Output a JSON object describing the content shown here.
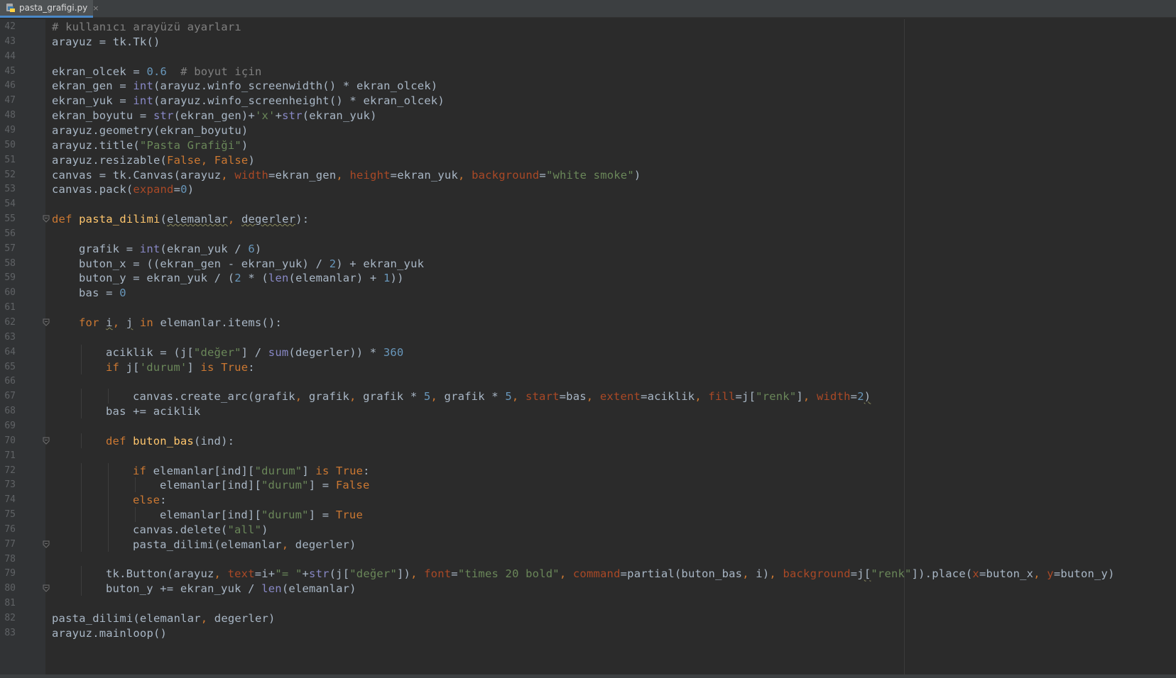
{
  "tab": {
    "filename": "pasta_grafigi.py",
    "close_glyph": "×",
    "icon": "python-file-icon",
    "accent_color": "#4a88c7"
  },
  "colors": {
    "background": "#2b2b2b",
    "gutter": "#313335",
    "keyword": "#cc7832",
    "function": "#ffc66d",
    "string": "#6a8759",
    "number": "#6897bb",
    "comment": "#808080",
    "parameter": "#aa4926",
    "builtin": "#8888c6",
    "text": "#a9b7c6"
  },
  "lines": [
    {
      "n": "42",
      "indent": 0,
      "fold": false,
      "tokens": [
        {
          "t": "# kullanıcı arayüzü ayarları",
          "c": "com"
        }
      ]
    },
    {
      "n": "43",
      "indent": 0,
      "fold": false,
      "tokens": [
        {
          "t": "arayuz = tk.Tk()",
          "c": "tx"
        }
      ]
    },
    {
      "n": "44",
      "indent": 0,
      "fold": false,
      "tokens": []
    },
    {
      "n": "45",
      "indent": 0,
      "fold": false,
      "tokens": [
        {
          "t": "ekran_olcek = ",
          "c": "tx"
        },
        {
          "t": "0.6",
          "c": "num"
        },
        {
          "t": "  ",
          "c": "tx"
        },
        {
          "t": "# boyut için",
          "c": "com"
        }
      ]
    },
    {
      "n": "46",
      "indent": 0,
      "fold": false,
      "tokens": [
        {
          "t": "ekran_gen = ",
          "c": "tx"
        },
        {
          "t": "int",
          "c": "bi"
        },
        {
          "t": "(arayuz.winfo_screenwidth() * ekran_olcek)",
          "c": "tx"
        }
      ]
    },
    {
      "n": "47",
      "indent": 0,
      "fold": false,
      "tokens": [
        {
          "t": "ekran_yuk = ",
          "c": "tx"
        },
        {
          "t": "int",
          "c": "bi"
        },
        {
          "t": "(arayuz.winfo_screenheight() * ekran_olcek)",
          "c": "tx"
        }
      ]
    },
    {
      "n": "48",
      "indent": 0,
      "fold": false,
      "tokens": [
        {
          "t": "ekran_boyutu = ",
          "c": "tx"
        },
        {
          "t": "str",
          "c": "bi"
        },
        {
          "t": "(ekran_gen)+",
          "c": "tx"
        },
        {
          "t": "'x'",
          "c": "str"
        },
        {
          "t": "+",
          "c": "tx"
        },
        {
          "t": "str",
          "c": "bi"
        },
        {
          "t": "(ekran_yuk)",
          "c": "tx"
        }
      ]
    },
    {
      "n": "49",
      "indent": 0,
      "fold": false,
      "tokens": [
        {
          "t": "arayuz.geometry(ekran_boyutu)",
          "c": "tx"
        }
      ]
    },
    {
      "n": "50",
      "indent": 0,
      "fold": false,
      "tokens": [
        {
          "t": "arayuz.title(",
          "c": "tx"
        },
        {
          "t": "\"Pasta Grafiği\"",
          "c": "str"
        },
        {
          "t": ")",
          "c": "tx"
        }
      ]
    },
    {
      "n": "51",
      "indent": 0,
      "fold": false,
      "tokens": [
        {
          "t": "arayuz.resizable(",
          "c": "tx"
        },
        {
          "t": "False, False",
          "c": "kw"
        },
        {
          "t": ")",
          "c": "tx"
        }
      ]
    },
    {
      "n": "52",
      "indent": 0,
      "fold": false,
      "tokens": [
        {
          "t": "canvas = tk.Canvas(arayuz",
          "c": "tx"
        },
        {
          "t": ", ",
          "c": "kw"
        },
        {
          "t": "width",
          "c": "prm"
        },
        {
          "t": "=ekran_gen",
          "c": "tx"
        },
        {
          "t": ", ",
          "c": "kw"
        },
        {
          "t": "height",
          "c": "prm"
        },
        {
          "t": "=ekran_yuk",
          "c": "tx"
        },
        {
          "t": ", ",
          "c": "kw"
        },
        {
          "t": "background",
          "c": "prm"
        },
        {
          "t": "=",
          "c": "tx"
        },
        {
          "t": "\"white smoke\"",
          "c": "str"
        },
        {
          "t": ")",
          "c": "tx"
        }
      ]
    },
    {
      "n": "53",
      "indent": 0,
      "fold": false,
      "tokens": [
        {
          "t": "canvas.pack(",
          "c": "tx"
        },
        {
          "t": "expand",
          "c": "prm"
        },
        {
          "t": "=",
          "c": "tx"
        },
        {
          "t": "0",
          "c": "num"
        },
        {
          "t": ")",
          "c": "tx"
        }
      ]
    },
    {
      "n": "54",
      "indent": 0,
      "fold": false,
      "tokens": []
    },
    {
      "n": "55",
      "indent": 0,
      "fold": true,
      "tokens": [
        {
          "t": "def ",
          "c": "kw"
        },
        {
          "t": "pasta_dilimi",
          "c": "fn"
        },
        {
          "t": "(",
          "c": "tx"
        },
        {
          "t": "elemanlar",
          "c": "tx",
          "sq": true
        },
        {
          "t": ", ",
          "c": "kw"
        },
        {
          "t": "degerler",
          "c": "tx",
          "sq": true
        },
        {
          "t": "):",
          "c": "tx"
        }
      ]
    },
    {
      "n": "56",
      "indent": 0,
      "fold": false,
      "tokens": []
    },
    {
      "n": "57",
      "indent": 1,
      "fold": false,
      "tokens": [
        {
          "t": "grafik = ",
          "c": "tx"
        },
        {
          "t": "int",
          "c": "bi"
        },
        {
          "t": "(ekran_yuk / ",
          "c": "tx"
        },
        {
          "t": "6",
          "c": "num"
        },
        {
          "t": ")",
          "c": "tx"
        }
      ]
    },
    {
      "n": "58",
      "indent": 1,
      "fold": false,
      "tokens": [
        {
          "t": "buton_x = ((ekran_gen - ekran_yuk) / ",
          "c": "tx"
        },
        {
          "t": "2",
          "c": "num"
        },
        {
          "t": ") + ekran_yuk",
          "c": "tx"
        }
      ]
    },
    {
      "n": "59",
      "indent": 1,
      "fold": false,
      "tokens": [
        {
          "t": "buton_y = ekran_yuk / (",
          "c": "tx"
        },
        {
          "t": "2",
          "c": "num"
        },
        {
          "t": " * (",
          "c": "tx"
        },
        {
          "t": "len",
          "c": "bi"
        },
        {
          "t": "(elemanlar) + ",
          "c": "tx"
        },
        {
          "t": "1",
          "c": "num"
        },
        {
          "t": "))",
          "c": "tx"
        }
      ]
    },
    {
      "n": "60",
      "indent": 1,
      "fold": false,
      "tokens": [
        {
          "t": "bas = ",
          "c": "tx"
        },
        {
          "t": "0",
          "c": "num"
        }
      ]
    },
    {
      "n": "61",
      "indent": 0,
      "fold": false,
      "tokens": []
    },
    {
      "n": "62",
      "indent": 1,
      "fold": true,
      "tokens": [
        {
          "t": "for ",
          "c": "kw"
        },
        {
          "t": "i",
          "c": "tx",
          "sq": true
        },
        {
          "t": ", ",
          "c": "kw"
        },
        {
          "t": "j",
          "c": "tx",
          "sq": true
        },
        {
          "t": " in ",
          "c": "kw"
        },
        {
          "t": "elemanlar.items():",
          "c": "tx"
        }
      ]
    },
    {
      "n": "63",
      "indent": 0,
      "fold": false,
      "tokens": []
    },
    {
      "n": "64",
      "indent": 2,
      "fold": false,
      "tokens": [
        {
          "t": "aciklik = (j[",
          "c": "tx"
        },
        {
          "t": "\"değer\"",
          "c": "str"
        },
        {
          "t": "] / ",
          "c": "tx"
        },
        {
          "t": "sum",
          "c": "bi"
        },
        {
          "t": "(degerler)) * ",
          "c": "tx"
        },
        {
          "t": "360",
          "c": "num"
        }
      ]
    },
    {
      "n": "65",
      "indent": 2,
      "fold": false,
      "tokens": [
        {
          "t": "if ",
          "c": "kw"
        },
        {
          "t": "j[",
          "c": "tx"
        },
        {
          "t": "'durum'",
          "c": "str"
        },
        {
          "t": "] ",
          "c": "tx"
        },
        {
          "t": "is True",
          "c": "kw"
        },
        {
          "t": ":",
          "c": "tx"
        }
      ]
    },
    {
      "n": "66",
      "indent": 0,
      "fold": false,
      "tokens": []
    },
    {
      "n": "67",
      "indent": 3,
      "fold": false,
      "tokens": [
        {
          "t": "canvas.create_arc(grafik",
          "c": "tx"
        },
        {
          "t": ", ",
          "c": "kw"
        },
        {
          "t": "grafik",
          "c": "tx"
        },
        {
          "t": ", ",
          "c": "kw"
        },
        {
          "t": "grafik * ",
          "c": "tx"
        },
        {
          "t": "5",
          "c": "num"
        },
        {
          "t": ", ",
          "c": "kw"
        },
        {
          "t": "grafik * ",
          "c": "tx"
        },
        {
          "t": "5",
          "c": "num"
        },
        {
          "t": ", ",
          "c": "kw"
        },
        {
          "t": "start",
          "c": "prm"
        },
        {
          "t": "=bas",
          "c": "tx"
        },
        {
          "t": ", ",
          "c": "kw"
        },
        {
          "t": "extent",
          "c": "prm"
        },
        {
          "t": "=aciklik",
          "c": "tx"
        },
        {
          "t": ", ",
          "c": "kw"
        },
        {
          "t": "fill",
          "c": "prm"
        },
        {
          "t": "=j[",
          "c": "tx"
        },
        {
          "t": "\"renk\"",
          "c": "str"
        },
        {
          "t": "]",
          "c": "tx"
        },
        {
          "t": ", ",
          "c": "kw"
        },
        {
          "t": "width",
          "c": "prm"
        },
        {
          "t": "=",
          "c": "tx"
        },
        {
          "t": "2",
          "c": "num"
        },
        {
          "t": ")",
          "c": "tx",
          "sq": true
        }
      ]
    },
    {
      "n": "68",
      "indent": 2,
      "fold": false,
      "tokens": [
        {
          "t": "bas += aciklik",
          "c": "tx"
        }
      ]
    },
    {
      "n": "69",
      "indent": 0,
      "fold": false,
      "tokens": []
    },
    {
      "n": "70",
      "indent": 2,
      "fold": true,
      "tokens": [
        {
          "t": "def ",
          "c": "kw"
        },
        {
          "t": "buton_bas",
          "c": "fn"
        },
        {
          "t": "(ind):",
          "c": "tx"
        }
      ]
    },
    {
      "n": "71",
      "indent": 0,
      "fold": false,
      "tokens": []
    },
    {
      "n": "72",
      "indent": 3,
      "fold": false,
      "tokens": [
        {
          "t": "if ",
          "c": "kw"
        },
        {
          "t": "elemanlar[ind][",
          "c": "tx"
        },
        {
          "t": "\"durum\"",
          "c": "str"
        },
        {
          "t": "] ",
          "c": "tx"
        },
        {
          "t": "is True",
          "c": "kw"
        },
        {
          "t": ":",
          "c": "tx"
        }
      ]
    },
    {
      "n": "73",
      "indent": 4,
      "fold": false,
      "tokens": [
        {
          "t": "elemanlar[ind][",
          "c": "tx"
        },
        {
          "t": "\"durum\"",
          "c": "str"
        },
        {
          "t": "] = ",
          "c": "tx"
        },
        {
          "t": "False",
          "c": "kw"
        }
      ]
    },
    {
      "n": "74",
      "indent": 3,
      "fold": false,
      "tokens": [
        {
          "t": "else",
          "c": "kw"
        },
        {
          "t": ":",
          "c": "tx"
        }
      ]
    },
    {
      "n": "75",
      "indent": 4,
      "fold": false,
      "tokens": [
        {
          "t": "elemanlar[ind][",
          "c": "tx"
        },
        {
          "t": "\"durum\"",
          "c": "str"
        },
        {
          "t": "] = ",
          "c": "tx"
        },
        {
          "t": "True",
          "c": "kw"
        }
      ]
    },
    {
      "n": "76",
      "indent": 3,
      "fold": false,
      "tokens": [
        {
          "t": "canvas.delete(",
          "c": "tx"
        },
        {
          "t": "\"all\"",
          "c": "str"
        },
        {
          "t": ")",
          "c": "tx"
        }
      ]
    },
    {
      "n": "77",
      "indent": 3,
      "fold": true,
      "tokens": [
        {
          "t": "pasta_dilimi(elemanlar",
          "c": "tx"
        },
        {
          "t": ", ",
          "c": "kw"
        },
        {
          "t": "degerler)",
          "c": "tx"
        }
      ]
    },
    {
      "n": "78",
      "indent": 0,
      "fold": false,
      "tokens": []
    },
    {
      "n": "79",
      "indent": 2,
      "fold": false,
      "tokens": [
        {
          "t": "tk.Button(arayuz",
          "c": "tx"
        },
        {
          "t": ", ",
          "c": "kw"
        },
        {
          "t": "text",
          "c": "prm"
        },
        {
          "t": "=i+",
          "c": "tx"
        },
        {
          "t": "\"= \"",
          "c": "str"
        },
        {
          "t": "+",
          "c": "tx"
        },
        {
          "t": "str",
          "c": "bi"
        },
        {
          "t": "(j[",
          "c": "tx"
        },
        {
          "t": "\"değer\"",
          "c": "str"
        },
        {
          "t": "])",
          "c": "tx"
        },
        {
          "t": ", ",
          "c": "kw"
        },
        {
          "t": "font",
          "c": "prm"
        },
        {
          "t": "=",
          "c": "tx"
        },
        {
          "t": "\"times 20 bold\"",
          "c": "str"
        },
        {
          "t": ", ",
          "c": "kw"
        },
        {
          "t": "command",
          "c": "prm"
        },
        {
          "t": "=partial(buton_bas",
          "c": "tx"
        },
        {
          "t": ", ",
          "c": "kw"
        },
        {
          "t": "i)",
          "c": "tx"
        },
        {
          "t": ", ",
          "c": "kw"
        },
        {
          "t": "background",
          "c": "prm"
        },
        {
          "t": "=j",
          "c": "tx"
        },
        {
          "t": "[",
          "c": "tx",
          "sq": true
        },
        {
          "t": "\"renk\"",
          "c": "str"
        },
        {
          "t": "]).place(",
          "c": "tx"
        },
        {
          "t": "x",
          "c": "prm"
        },
        {
          "t": "=buton_x",
          "c": "tx"
        },
        {
          "t": ", ",
          "c": "kw"
        },
        {
          "t": "y",
          "c": "prm"
        },
        {
          "t": "=buton_y)",
          "c": "tx"
        }
      ]
    },
    {
      "n": "80",
      "indent": 2,
      "fold": true,
      "tokens": [
        {
          "t": "buton_y += ekran_yuk / ",
          "c": "tx"
        },
        {
          "t": "len",
          "c": "bi"
        },
        {
          "t": "(elemanlar)",
          "c": "tx"
        }
      ]
    },
    {
      "n": "81",
      "indent": 0,
      "fold": false,
      "tokens": []
    },
    {
      "n": "82",
      "indent": 0,
      "fold": false,
      "tokens": [
        {
          "t": "pasta_dilimi(elemanlar",
          "c": "tx"
        },
        {
          "t": ", ",
          "c": "kw"
        },
        {
          "t": "degerler)",
          "c": "tx"
        }
      ]
    },
    {
      "n": "83",
      "indent": 0,
      "fold": false,
      "tokens": [
        {
          "t": "arayuz.mainloop()",
          "c": "tx"
        }
      ]
    }
  ]
}
